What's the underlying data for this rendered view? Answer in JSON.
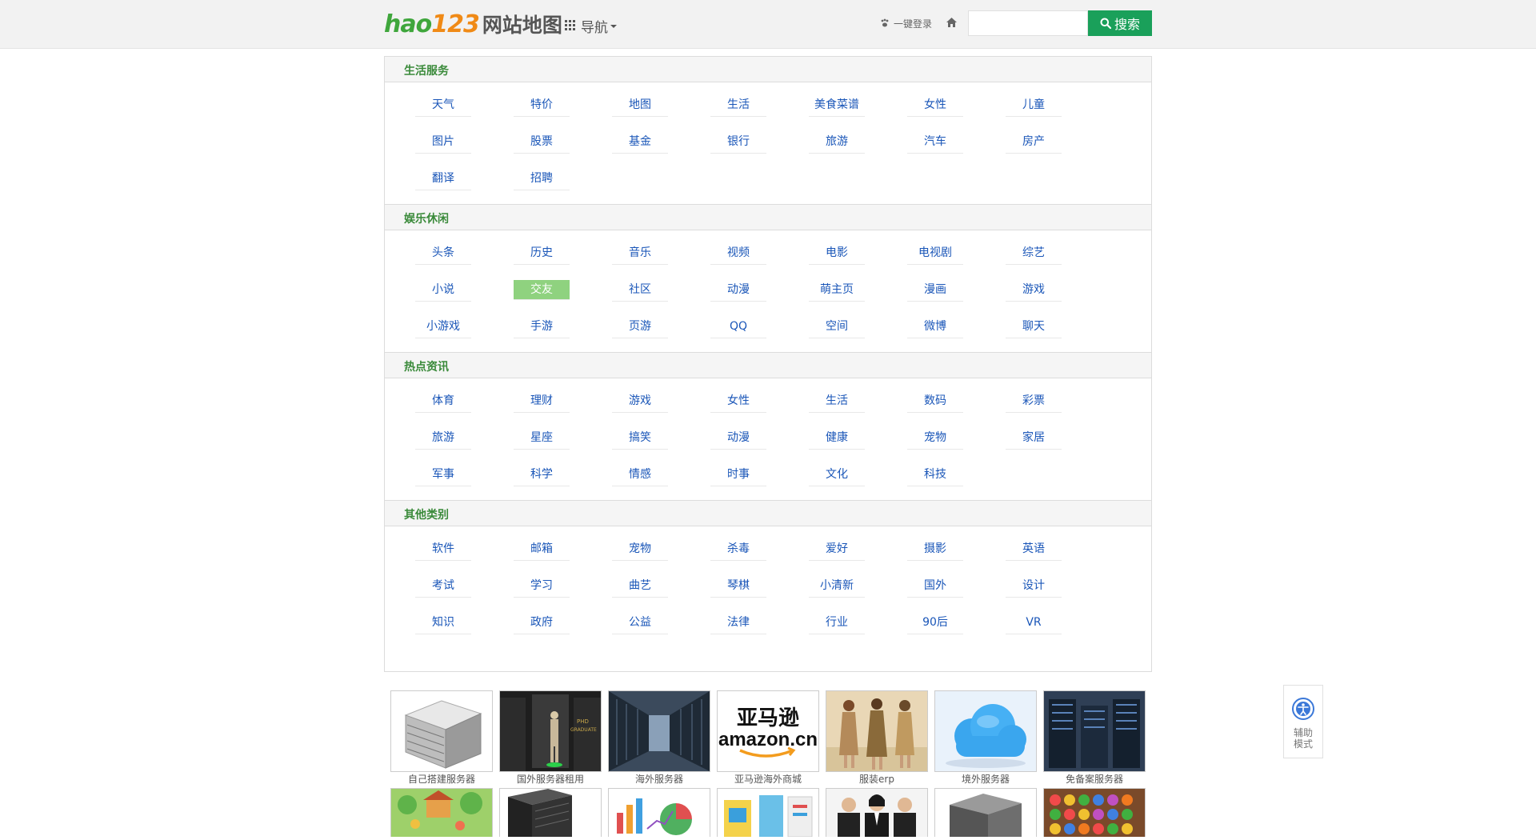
{
  "header": {
    "logo_hao": "hao",
    "logo_num": "123",
    "logo_text": "网站地图",
    "nav_label": "导航",
    "login_label": "一键登录",
    "search_placeholder": "",
    "search_button": "搜索"
  },
  "sections": [
    {
      "title": "生活服务",
      "items": [
        "天气",
        "特价",
        "地图",
        "生活",
        "美食菜谱",
        "女性",
        "儿童",
        "图片",
        "股票",
        "基金",
        "银行",
        "旅游",
        "汽车",
        "房产",
        "翻译",
        "招聘"
      ]
    },
    {
      "title": "娱乐休闲",
      "items": [
        "头条",
        "历史",
        "音乐",
        "视频",
        "电影",
        "电视剧",
        "综艺",
        "小说",
        "交友",
        "社区",
        "动漫",
        "萌主页",
        "漫画",
        "游戏",
        "小游戏",
        "手游",
        "页游",
        "QQ",
        "空间",
        "微博",
        "聊天"
      ],
      "active_item": "交友"
    },
    {
      "title": "热点资讯",
      "items": [
        "体育",
        "理财",
        "游戏",
        "女性",
        "生活",
        "数码",
        "彩票",
        "旅游",
        "星座",
        "搞笑",
        "动漫",
        "健康",
        "宠物",
        "家居",
        "军事",
        "科学",
        "情感",
        "时事",
        "文化",
        "科技"
      ]
    },
    {
      "title": "其他类别",
      "items": [
        "软件",
        "邮箱",
        "宠物",
        "杀毒",
        "爱好",
        "摄影",
        "英语",
        "考试",
        "学习",
        "曲艺",
        "琴棋",
        "小清新",
        "国外",
        "设计",
        "知识",
        "政府",
        "公益",
        "法律",
        "行业",
        "90后",
        "VR"
      ]
    }
  ],
  "gallery": {
    "row1": [
      {
        "caption": "自己搭建服务器",
        "image": "server-box"
      },
      {
        "caption": "国外服务器租用",
        "image": "phd-graduate-rack",
        "image_text": [
          "PHD",
          "GRADUATE"
        ]
      },
      {
        "caption": "海外服务器",
        "image": "datacenter-aisle"
      },
      {
        "caption": "亚马逊海外商城",
        "image": "amazon-logo",
        "image_text": [
          "亚马逊",
          "amazon.cn"
        ]
      },
      {
        "caption": "服装erp",
        "image": "fashion-models"
      },
      {
        "caption": "境外服务器",
        "image": "cloud"
      },
      {
        "caption": "免备案服务器",
        "image": "server-racks"
      }
    ],
    "row2": [
      {
        "image": "game-scene"
      },
      {
        "image": "server-tower"
      },
      {
        "image": "charts"
      },
      {
        "image": "documents"
      },
      {
        "image": "business-people"
      },
      {
        "image": "server-cabinet"
      },
      {
        "image": "candy-puzzle"
      }
    ]
  },
  "assist": {
    "label_line1": "辅助",
    "label_line2": "模式"
  },
  "colors": {
    "brand_green": "#3fa63c",
    "brand_orange": "#f08a16",
    "search_button": "#1aa05a",
    "link_blue": "#1a56b8",
    "section_title": "#3a8a3a",
    "active_tag": "#8fd27f"
  }
}
